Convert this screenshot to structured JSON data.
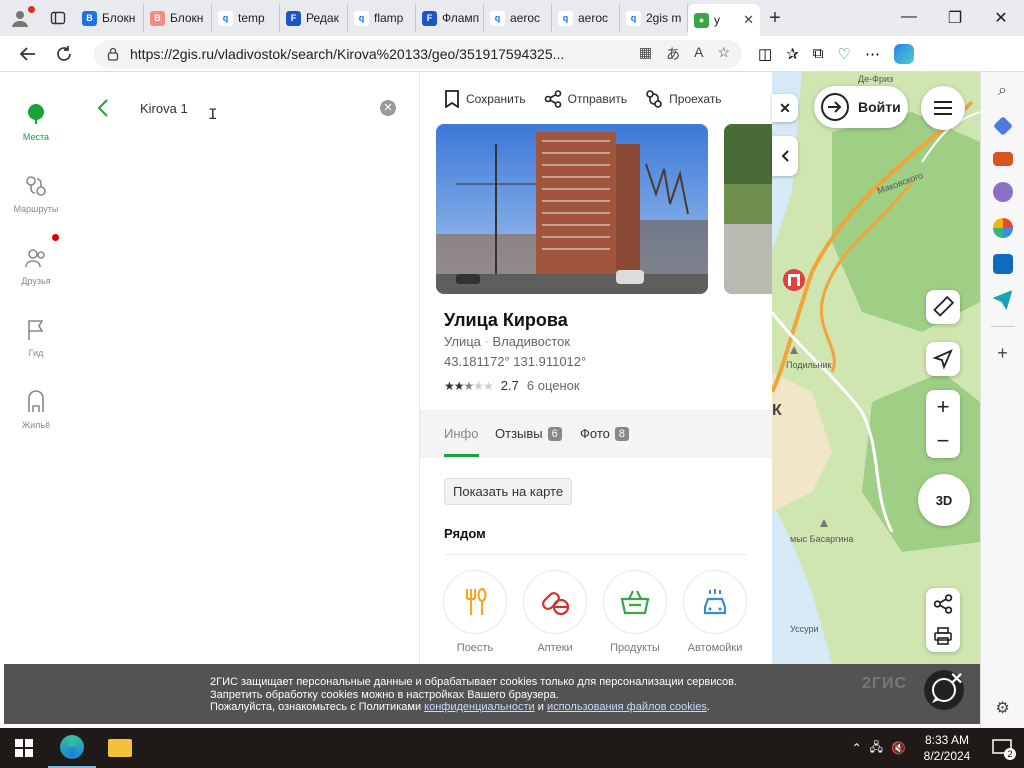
{
  "browser": {
    "tabs": [
      {
        "label": "Блокн",
        "fav_color": "#1a73e8",
        "fav_text": "B"
      },
      {
        "label": "Блокн",
        "fav_color": "#f28b82",
        "fav_text": "B"
      },
      {
        "label": "temp",
        "fav_color": "#ffffff",
        "fav_text": "q"
      },
      {
        "label": "Редак",
        "fav_color": "#1a56c4",
        "fav_text": "F"
      },
      {
        "label": "flamp",
        "fav_color": "#ffffff",
        "fav_text": "q"
      },
      {
        "label": "Фламп",
        "fav_color": "#1a56c4",
        "fav_text": "F"
      },
      {
        "label": "aeroc",
        "fav_color": "#ffffff",
        "fav_text": "q"
      },
      {
        "label": "aeroc",
        "fav_color": "#ffffff",
        "fav_text": "q"
      },
      {
        "label": "2gis m",
        "fav_color": "#ffffff",
        "fav_text": "q"
      }
    ],
    "active_tab": {
      "label": "y",
      "close": "✕"
    },
    "new_tab": "+",
    "url": "https://2gis.ru/vladivostok/search/Kirova%20133/geo/351917594325...",
    "window_controls": {
      "minimize": "—",
      "restore": "❐",
      "close": "✕"
    }
  },
  "leftnav": {
    "items": [
      {
        "label": "Места",
        "active": true
      },
      {
        "label": "Маршруты",
        "active": false
      },
      {
        "label": "Друзья",
        "active": false
      },
      {
        "label": "Гид",
        "active": false
      },
      {
        "label": "Жильё",
        "active": false
      }
    ]
  },
  "search": {
    "value": "Kirova 1",
    "cursor": "I",
    "clear": "✕"
  },
  "card": {
    "actions": {
      "save": "Сохранить",
      "share": "Отправить",
      "route": "Проехать"
    },
    "title": "Улица Кирова",
    "type": "Улица",
    "city": "Владивосток",
    "coords": "43.181172° 131.911012°",
    "rating": {
      "value": "2.7",
      "count": "6 оценок",
      "stars": 2.5
    },
    "tabs": [
      {
        "label": "Инфо",
        "badge": ""
      },
      {
        "label": "Отзывы",
        "badge": "6"
      },
      {
        "label": "Фото",
        "badge": "8"
      }
    ],
    "show_on_map": "Показать на карте",
    "nearby_title": "Рядом",
    "nearby": [
      {
        "label": "Поесть",
        "color": "#f5a623"
      },
      {
        "label": "Аптеки",
        "color": "#d0312d"
      },
      {
        "label": "Продукты",
        "color": "#3aa648"
      },
      {
        "label": "Автомойки",
        "color": "#3a8bd6"
      }
    ]
  },
  "map": {
    "login": "Войти",
    "labels": {
      "defriz": "Де-Фриз",
      "makovsky": "Маковского",
      "podlnik": "Подильник",
      "k": "К",
      "basargina": "мыс Басаргина",
      "ust": "Уссури"
    },
    "threed": "3D",
    "zoom_in": "+",
    "zoom_out": "−"
  },
  "cookie": {
    "line1": "2ГИС защищает персональные данные и обрабатывает cookies только для персонализации сервисов.",
    "line2": "Запретить обработку cookies можно в настройках Вашего браузера.",
    "line3_start": "Пожалуйста, ознакомьтесь с Политиками ",
    "link1": "конфиденциальности",
    "and": " и ",
    "link2": "использования файлов cookies",
    "dot": ".",
    "brand": "2ГИС",
    "close": "✕"
  },
  "taskbar": {
    "time": "8:33 AM",
    "date": "8/2/2024",
    "notifications": "2"
  }
}
